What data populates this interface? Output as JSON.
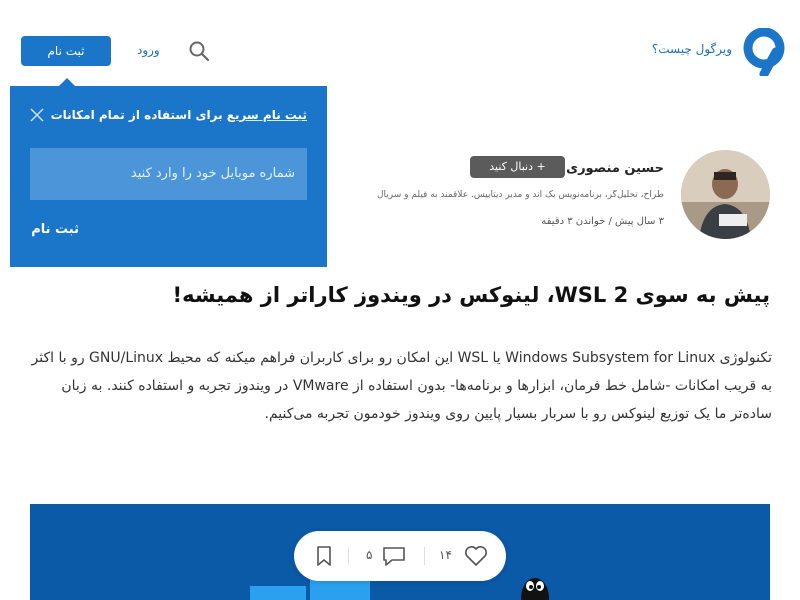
{
  "header": {
    "what_is_label": "ویرگول چیست؟",
    "login_label": "ورود",
    "signup_label": "ثبت نام"
  },
  "signup_popup": {
    "title_strong": "ثبت نام سریع",
    "title_rest": " برای استفاده از تمام امکانات",
    "phone_placeholder": "شماره موبایل خود را وارد کنید",
    "submit_label": "ثبت نام"
  },
  "author": {
    "name": "حسین منصوری",
    "follow_label": "+ دنبال کنید",
    "bio": "طراح، تحلیل‌گر، برنامه‌نویس بک اند و مدیر دیتابیس. علاقمند به فیلم و سریال",
    "post_meta": "۳ سال پیش / خواندن ۳ دقیقه"
  },
  "article": {
    "title": "پیش به سوی WSL 2، لینوکس در ویندوز کاراتر از همیشه!",
    "body": "تکنولوژی Windows Subsystem for Linux یا WSL این امکان رو برای کاربران فراهم میکنه که محیط GNU/Linux رو با اکثر به قریب امکانات -شامل خط فرمان، ابزارها و برنامه‌ها- بدون استفاده از VMware در ویندوز تجربه و استفاده کنند. به زبان ساده‌تر ما یک توزیع لینوکس رو با سربار بسیار پایین روی ویندوز خودمون تجربه می‌کنیم."
  },
  "actions": {
    "likes": "۱۴",
    "comments": "۵"
  },
  "colors": {
    "brand": "#1b75c8",
    "hero": "#0a5aa8"
  }
}
